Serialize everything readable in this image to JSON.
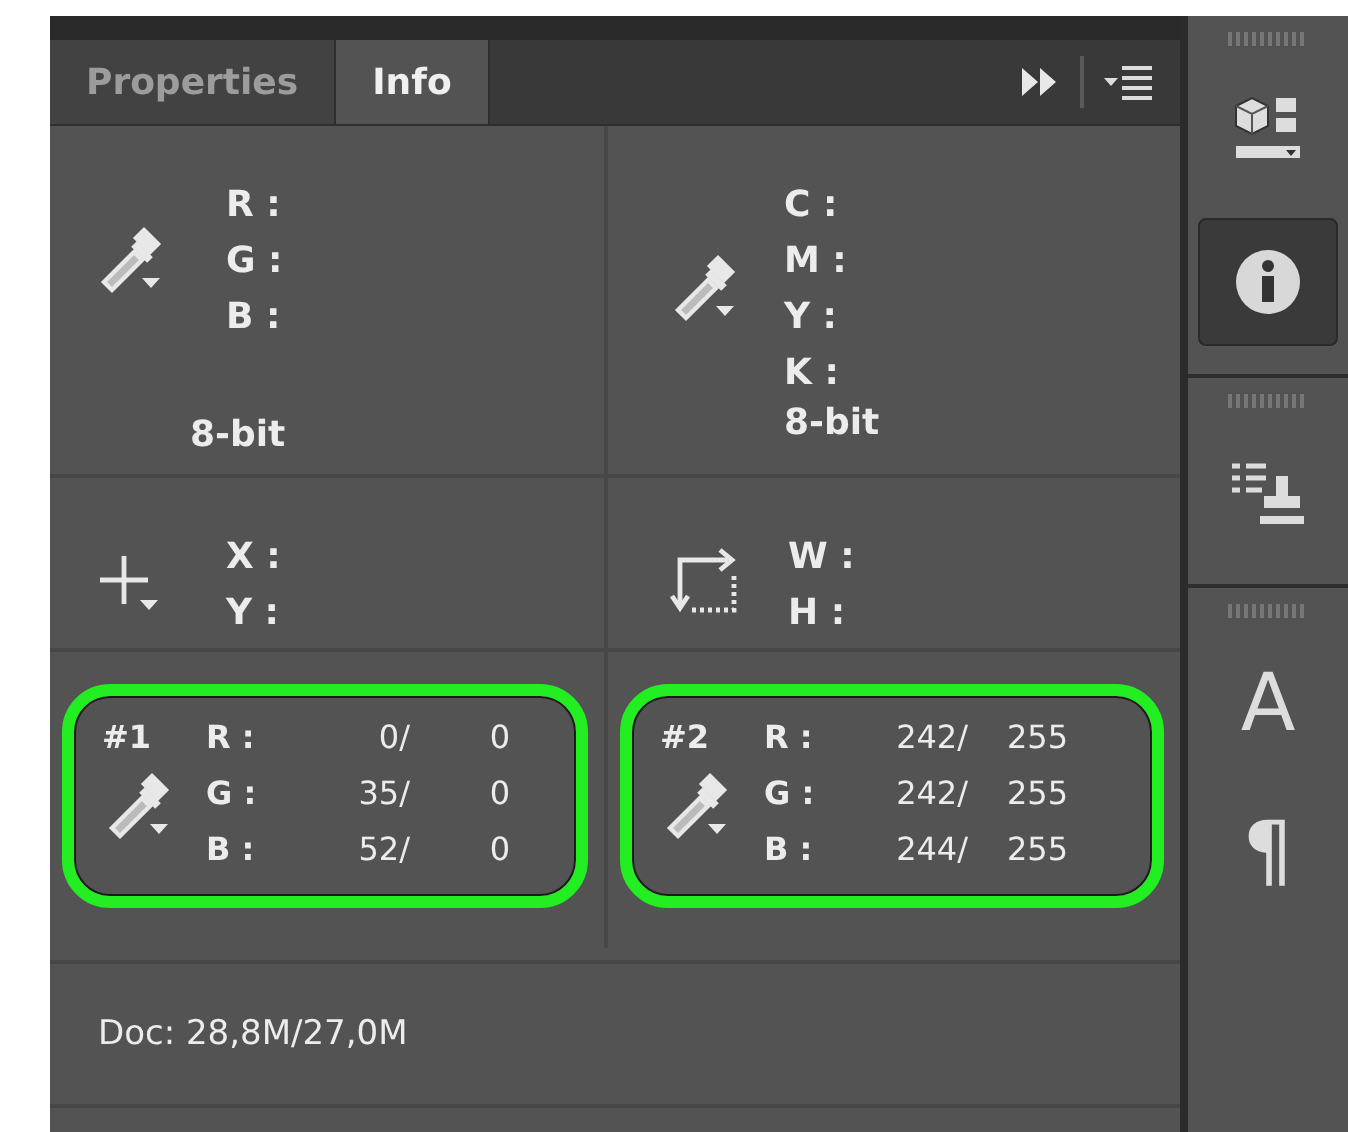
{
  "tabs": [
    {
      "label": "Properties",
      "selected": false
    },
    {
      "label": "Info",
      "selected": true
    }
  ],
  "cells": [
    {
      "kind": "color",
      "lines": [
        {
          "label": "R :"
        },
        {
          "label": "G :"
        },
        {
          "label": "B :"
        }
      ],
      "depth": "8-bit"
    },
    {
      "kind": "color",
      "lines": [
        {
          "label": "C :"
        },
        {
          "label": "M :"
        },
        {
          "label": "Y :"
        },
        {
          "label": "K :"
        }
      ],
      "depth": "8-bit"
    },
    {
      "kind": "position",
      "lines": [
        {
          "label": "X :"
        },
        {
          "label": "Y :"
        }
      ]
    },
    {
      "kind": "size",
      "lines": [
        {
          "label": "W :"
        },
        {
          "label": "H :"
        }
      ]
    },
    {
      "kind": "sample",
      "marker": "#1",
      "highlighted": true,
      "lines": [
        {
          "label": "R :",
          "value": "0/",
          "value_2": "0"
        },
        {
          "label": "G :",
          "value": "35/",
          "value_2": "0"
        },
        {
          "label": "B :",
          "value": "52/",
          "value_2": "0"
        }
      ]
    },
    {
      "kind": "sample",
      "marker": "#2",
      "highlighted": true,
      "lines": [
        {
          "label": "R :",
          "value": "242/",
          "value_2": "255"
        },
        {
          "label": "G :",
          "value": "242/",
          "value_2": "255"
        },
        {
          "label": "B :",
          "value": "244/",
          "value_2": "255"
        }
      ]
    }
  ],
  "status": "Doc: 28,8M/27,0M",
  "dock": [
    {
      "items": [
        {
          "kind": "icon",
          "selected": false
        },
        {
          "kind": "icon",
          "selected": true
        }
      ]
    },
    {
      "items": [
        {
          "kind": "icon",
          "selected": false
        }
      ]
    },
    {
      "items": [
        {
          "kind": "glyph",
          "text": "A",
          "selected": false
        },
        {
          "kind": "glyph",
          "text": "¶",
          "selected": false
        }
      ]
    }
  ]
}
